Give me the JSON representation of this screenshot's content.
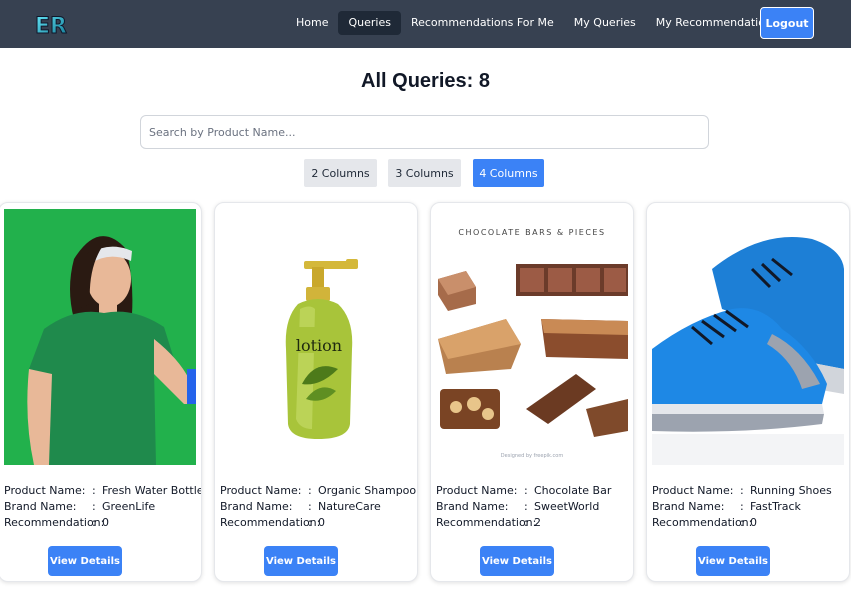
{
  "nav": {
    "logo_text": "ER",
    "links": [
      {
        "label": "Home"
      },
      {
        "label": "Queries"
      },
      {
        "label": "Recommendations For Me"
      },
      {
        "label": "My Queries"
      },
      {
        "label": "My Recommendations"
      }
    ],
    "active_link": "Queries",
    "logout_label": "Logout"
  },
  "page": {
    "title": "All Queries: 8"
  },
  "search": {
    "placeholder": "Search by Product Name...",
    "value": ""
  },
  "column_options": [
    {
      "label": "2 Columns",
      "active": false
    },
    {
      "label": "3 Columns",
      "active": false
    },
    {
      "label": "4 Columns",
      "active": true
    }
  ],
  "labels": {
    "product_name": "Product Name:",
    "brand_name": "Brand Name:",
    "recommendation": "Recommendation:",
    "separator": ":",
    "view_details": "View Details"
  },
  "products": [
    {
      "product_name": "Fresh Water Bottle",
      "brand_name": "GreenLife",
      "recommendation": "0",
      "image": "woman-green-shirt-photo"
    },
    {
      "product_name": "Organic Shampoo",
      "brand_name": "NatureCare",
      "recommendation": "0",
      "image": "lotion-bottle-photo"
    },
    {
      "product_name": "Chocolate Bar",
      "brand_name": "SweetWorld",
      "recommendation": "2",
      "image": "chocolate-bars-illustration",
      "image_caption": "CHOCOLATE BARS & PIECES",
      "image_watermark": "Designed by freepik.com"
    },
    {
      "product_name": "Running Shoes",
      "brand_name": "FastTrack",
      "recommendation": "0",
      "image": "blue-running-shoes-photo"
    }
  ],
  "colors": {
    "navbar": "#374151",
    "accent": "#3b82f6",
    "toggle_inactive": "#e5e7eb"
  }
}
